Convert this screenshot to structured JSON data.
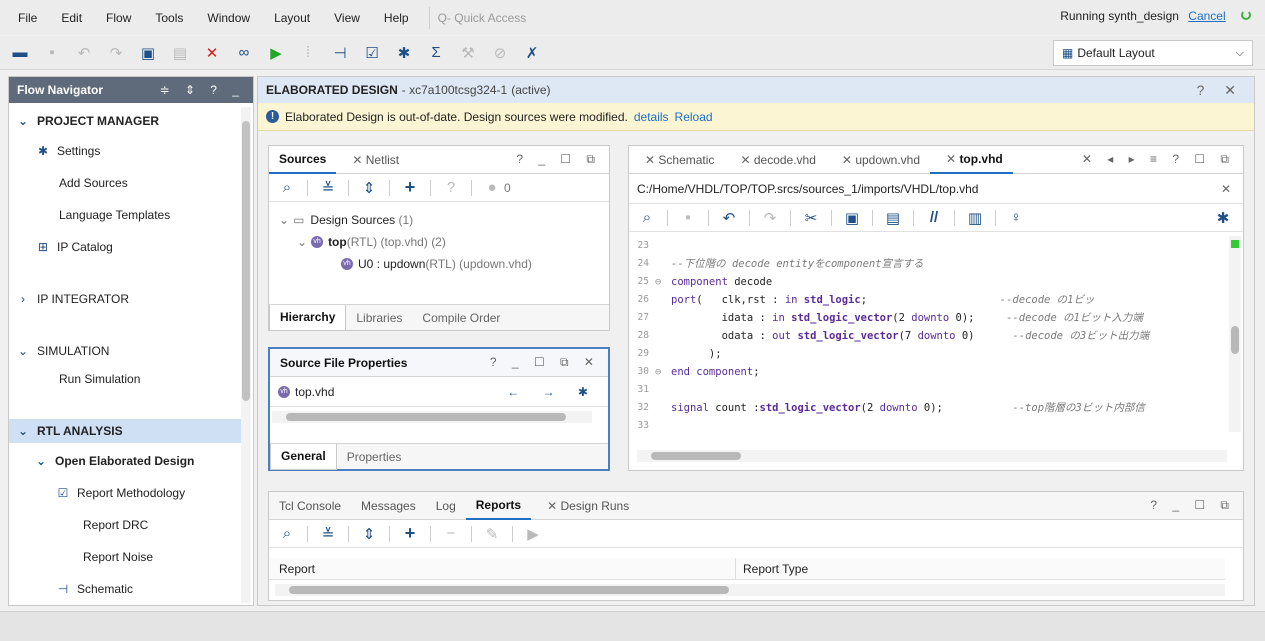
{
  "menubar": {
    "items": [
      "File",
      "Edit",
      "Flow",
      "Tools",
      "Window",
      "Layout",
      "View",
      "Help"
    ],
    "quick_access": "Q- Quick Access",
    "status_text": "Running synth_design",
    "cancel": "Cancel"
  },
  "toolbar": {
    "layout": "Default Layout"
  },
  "nav": {
    "title": "Flow Navigator",
    "controls": "≑ ⇕ ? _",
    "items": [
      {
        "label": "PROJECT MANAGER",
        "kind": "section"
      },
      {
        "label": "Settings",
        "icon": "gear-icon"
      },
      {
        "label": "Add Sources"
      },
      {
        "label": "Language Templates"
      },
      {
        "label": "IP Catalog",
        "icon": "ip-icon"
      },
      {
        "label": "IP INTEGRATOR",
        "kind": "section"
      },
      {
        "label": "SIMULATION",
        "kind": "section"
      },
      {
        "label": "Run Simulation"
      },
      {
        "label": "RTL ANALYSIS",
        "kind": "section"
      },
      {
        "label": "Open Elaborated Design"
      },
      {
        "label": "Report Methodology",
        "icon": "clipboard-icon"
      },
      {
        "label": "Report DRC"
      },
      {
        "label": "Report Noise"
      },
      {
        "label": "Schematic",
        "icon": "schematic-icon"
      }
    ]
  },
  "main": {
    "title": "ELABORATED DESIGN",
    "device": "- xc7a100tcsg324-1",
    "state": "(active)",
    "warning": "Elaborated Design is out-of-date. Design sources were modified.",
    "details": "details",
    "reload": "Reload"
  },
  "sources": {
    "tabs": [
      "Sources",
      "Netlist"
    ],
    "count": "0",
    "tree": {
      "root": "Design Sources",
      "root_count": "(1)",
      "top": "top",
      "top_meta": "(RTL) (top.vhd) (2)",
      "child": "U0 : updown",
      "child_meta": "(RTL) (updown.vhd)"
    },
    "bottom_tabs": [
      "Hierarchy",
      "Libraries",
      "Compile Order"
    ]
  },
  "props": {
    "title": "Source File Properties",
    "file": "top.vhd",
    "bottom_tabs": [
      "General",
      "Properties"
    ]
  },
  "editor": {
    "tabs": [
      "Schematic",
      "decode.vhd",
      "updown.vhd",
      "top.vhd"
    ],
    "path": "C:/Home/VHDL/TOP/TOP.srcs/sources_1/imports/VHDL/top.vhd",
    "lines": [
      {
        "n": "23",
        "segs": [
          {
            "t": ""
          }
        ]
      },
      {
        "n": "24",
        "segs": [
          {
            "t": "--下位階の decode entityをcomponent宣言する",
            "c": "cm"
          }
        ]
      },
      {
        "n": "25",
        "segs": [
          {
            "t": "component",
            "c": "kw"
          },
          {
            "t": " decode"
          }
        ]
      },
      {
        "n": "26",
        "segs": [
          {
            "t": "port",
            "c": "kw"
          },
          {
            "t": "(   clk,rst : "
          },
          {
            "t": "in",
            "c": "kw"
          },
          {
            "t": " "
          },
          {
            "t": "std_logic",
            "c": "kwb"
          },
          {
            "t": ";                     "
          },
          {
            "t": "--decode の1ビッ",
            "c": "cm"
          }
        ]
      },
      {
        "n": "27",
        "segs": [
          {
            "t": "        idata : "
          },
          {
            "t": "in",
            "c": "kw"
          },
          {
            "t": " "
          },
          {
            "t": "std_logic_vector",
            "c": "kwb"
          },
          {
            "t": "(2 "
          },
          {
            "t": "downto",
            "c": "kw"
          },
          {
            "t": " 0);     "
          },
          {
            "t": "--decode の1ビット入力端",
            "c": "cm"
          }
        ]
      },
      {
        "n": "28",
        "segs": [
          {
            "t": "        odata : "
          },
          {
            "t": "out",
            "c": "kw"
          },
          {
            "t": " "
          },
          {
            "t": "std_logic_vector",
            "c": "kwb"
          },
          {
            "t": "(7 "
          },
          {
            "t": "downto",
            "c": "kw"
          },
          {
            "t": " 0)      "
          },
          {
            "t": "--decode の3ビット出力端",
            "c": "cm"
          }
        ]
      },
      {
        "n": "29",
        "segs": [
          {
            "t": "      );"
          }
        ]
      },
      {
        "n": "30",
        "segs": [
          {
            "t": "end component",
            "c": "kw"
          },
          {
            "t": ";"
          }
        ]
      },
      {
        "n": "31",
        "segs": [
          {
            "t": ""
          }
        ]
      },
      {
        "n": "32",
        "segs": [
          {
            "t": "signal",
            "c": "kw"
          },
          {
            "t": " count :"
          },
          {
            "t": "std_logic_vector",
            "c": "kwb"
          },
          {
            "t": "(2 "
          },
          {
            "t": "downto",
            "c": "kw"
          },
          {
            "t": " 0);           "
          },
          {
            "t": "--top階層の3ビット内部信",
            "c": "cm"
          }
        ]
      },
      {
        "n": "33",
        "segs": [
          {
            "t": ""
          }
        ]
      }
    ]
  },
  "console": {
    "tabs": [
      "Tcl Console",
      "Messages",
      "Log",
      "Reports",
      "Design Runs"
    ],
    "columns": [
      "Report",
      "Report Type"
    ]
  }
}
